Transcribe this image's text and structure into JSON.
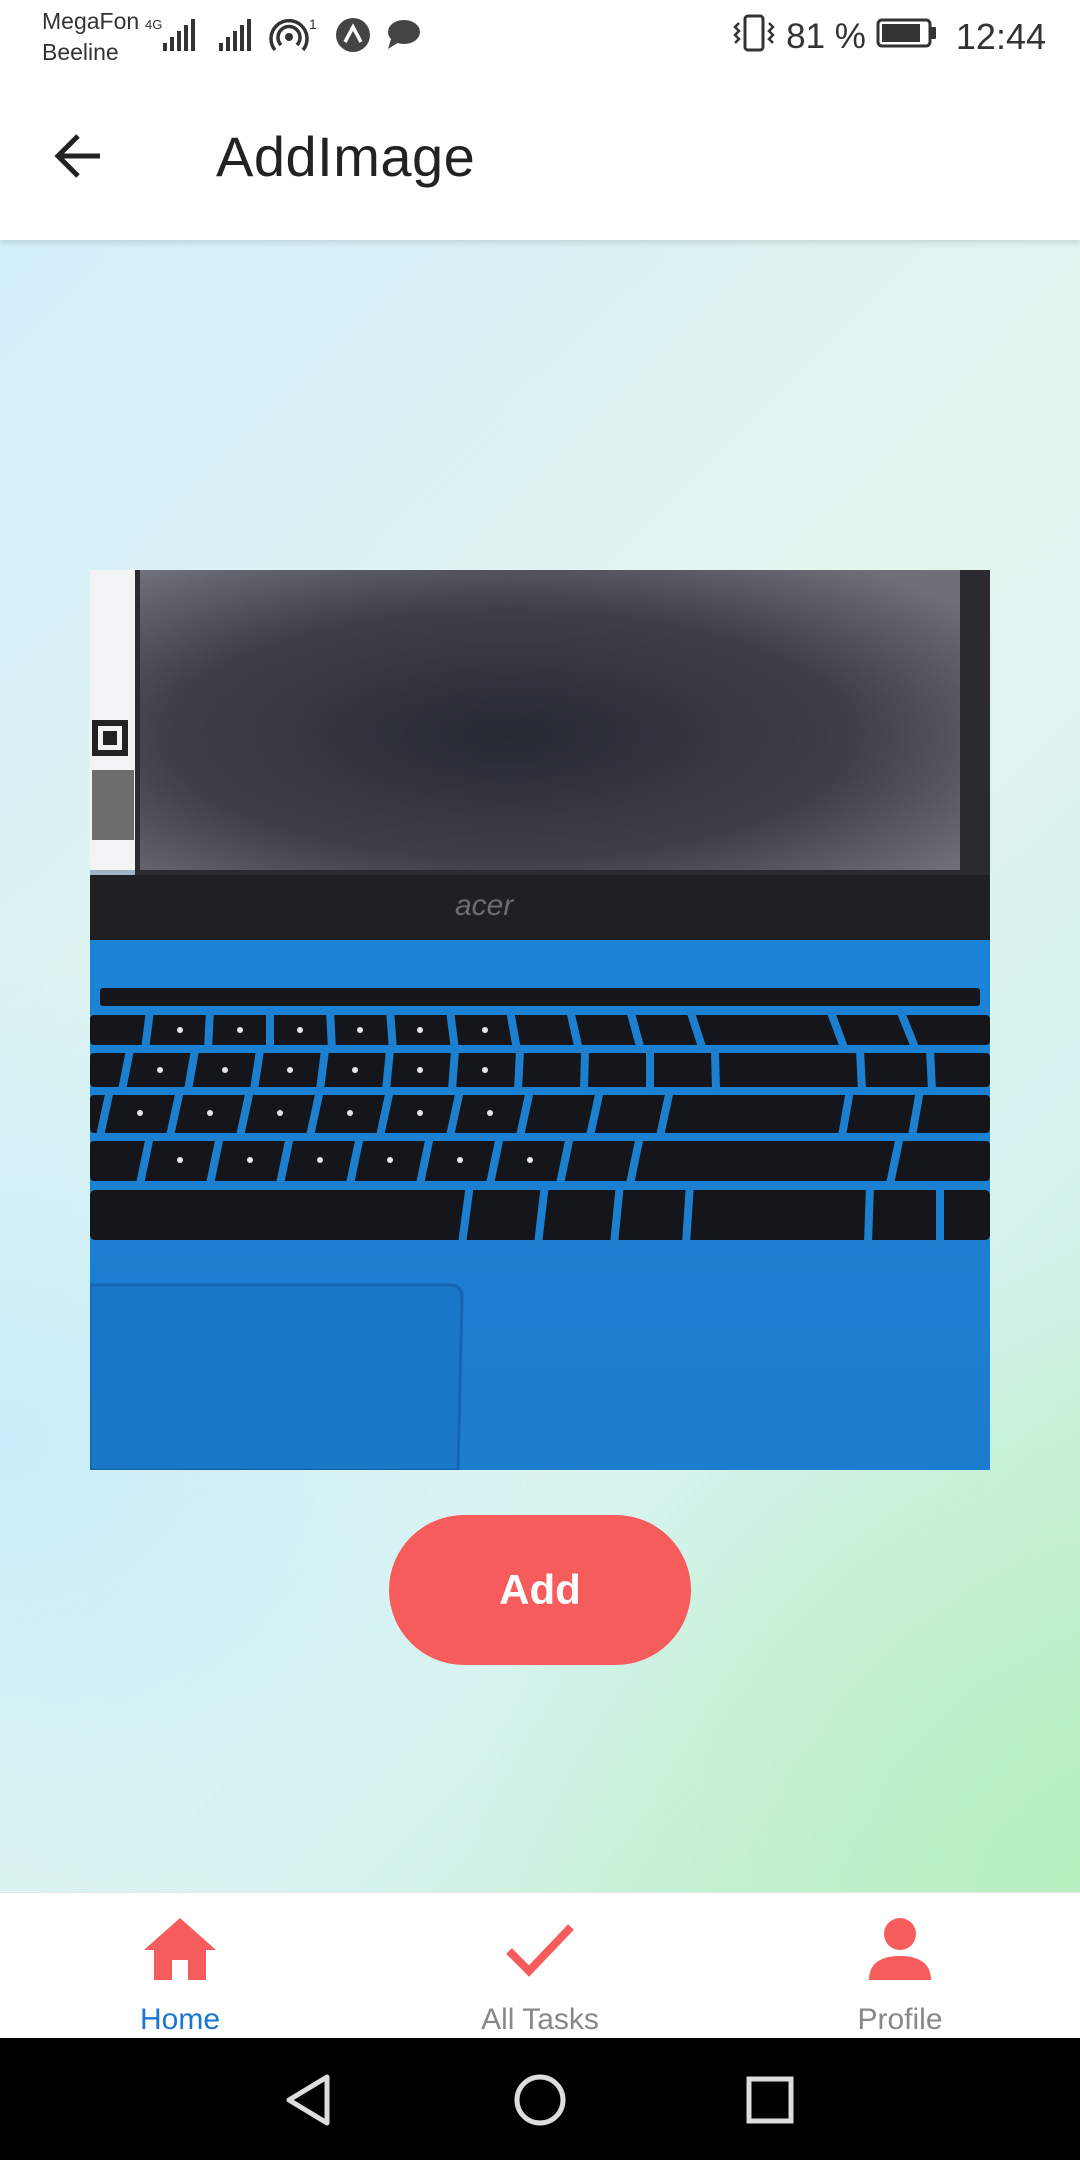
{
  "status_bar": {
    "carrier_1": "MegaFon",
    "carrier_2": "Beeline",
    "network_type": "4G",
    "notification_badge": "1",
    "battery": "81 %",
    "time": "12:44",
    "icons": [
      "signal-icon",
      "signal-icon",
      "hotspot-icon",
      "app-notification-icon",
      "message-icon",
      "vibrate-icon",
      "battery-icon"
    ]
  },
  "appbar": {
    "title": "AddImage",
    "back_icon": "arrow-back-icon"
  },
  "photo": {
    "brand_text": "acer"
  },
  "add_button": {
    "label": "Add"
  },
  "bottom_nav": {
    "items": [
      {
        "label": "Home",
        "icon": "home-icon",
        "active": true
      },
      {
        "label": "All Tasks",
        "icon": "check-icon",
        "active": false
      },
      {
        "label": "Profile",
        "icon": "person-icon",
        "active": false
      }
    ],
    "accent_color": "#f75c5c",
    "active_label_color": "#1976d2"
  },
  "system_nav": {
    "icons": [
      "back-triangle-icon",
      "home-circle-icon",
      "recents-square-icon"
    ]
  }
}
